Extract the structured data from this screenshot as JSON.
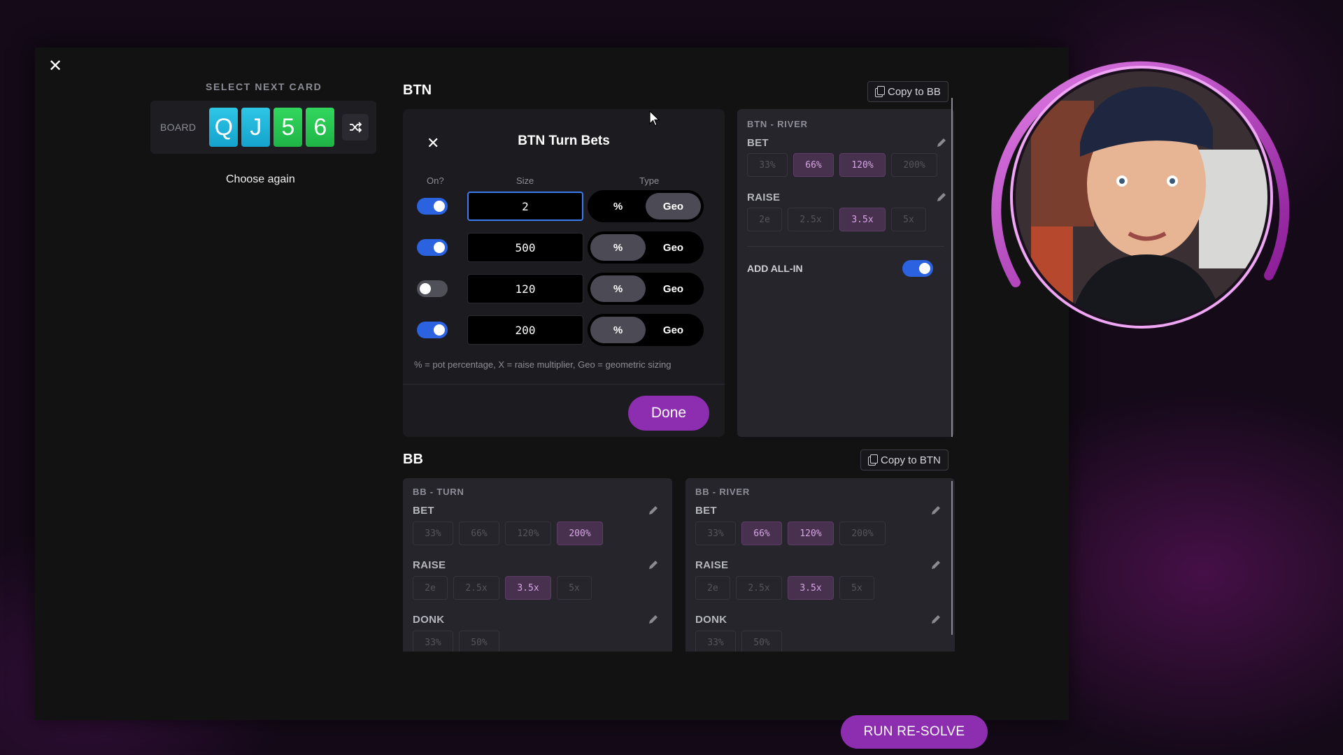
{
  "left": {
    "select_next_card": "SELECT NEXT CARD",
    "board_label": "BOARD",
    "cards": [
      "Q",
      "J",
      "5",
      "6"
    ],
    "choose_again": "Choose again"
  },
  "btn": {
    "title": "BTN",
    "copy_label": "Copy to BB",
    "modal": {
      "title": "BTN Turn Bets",
      "col_on": "On?",
      "col_size": "Size",
      "col_type": "Type",
      "rows": [
        {
          "on": true,
          "size": "2",
          "type": "Geo"
        },
        {
          "on": true,
          "size": "500",
          "type": "%"
        },
        {
          "on": false,
          "size": "120",
          "type": "%"
        },
        {
          "on": true,
          "size": "200",
          "type": "%"
        }
      ],
      "pct_label": "%",
      "geo_label": "Geo",
      "note": "% = pot percentage, X = raise multiplier, Geo = geometric sizing",
      "done": "Done"
    },
    "river": {
      "title": "BTN - RIVER",
      "bet_label": "BET",
      "bet_chips": [
        "33%",
        "66%",
        "120%",
        "200%"
      ],
      "raise_label": "RAISE",
      "raise_chips": [
        "2e",
        "2.5x",
        "3.5x",
        "5x"
      ],
      "add_all_in": "ADD ALL-IN"
    }
  },
  "bb": {
    "title": "BB",
    "copy_label": "Copy to BTN",
    "turn": {
      "title": "BB - TURN",
      "bet_label": "BET",
      "bet_chips": [
        "33%",
        "66%",
        "120%",
        "200%"
      ],
      "raise_label": "RAISE",
      "raise_chips": [
        "2e",
        "2.5x",
        "3.5x",
        "5x"
      ],
      "donk_label": "DONK",
      "donk_chips": [
        "33%",
        "50%"
      ]
    },
    "river": {
      "title": "BB - RIVER",
      "bet_label": "BET",
      "bet_chips": [
        "33%",
        "66%",
        "120%",
        "200%"
      ],
      "raise_label": "RAISE",
      "raise_chips": [
        "2e",
        "2.5x",
        "3.5x",
        "5x"
      ],
      "donk_label": "DONK",
      "donk_chips": [
        "33%",
        "50%"
      ]
    }
  },
  "run_resolve": "RUN RE-SOLVE",
  "colors": {
    "accent": "#8d2db0",
    "toggle_on": "#2a62e0",
    "card_blue": "#1fb4db",
    "card_green": "#28c850"
  },
  "icons": [
    "close-icon",
    "shuffle-icon",
    "copy-icon",
    "pencil-icon",
    "mouse-cursor-icon"
  ]
}
